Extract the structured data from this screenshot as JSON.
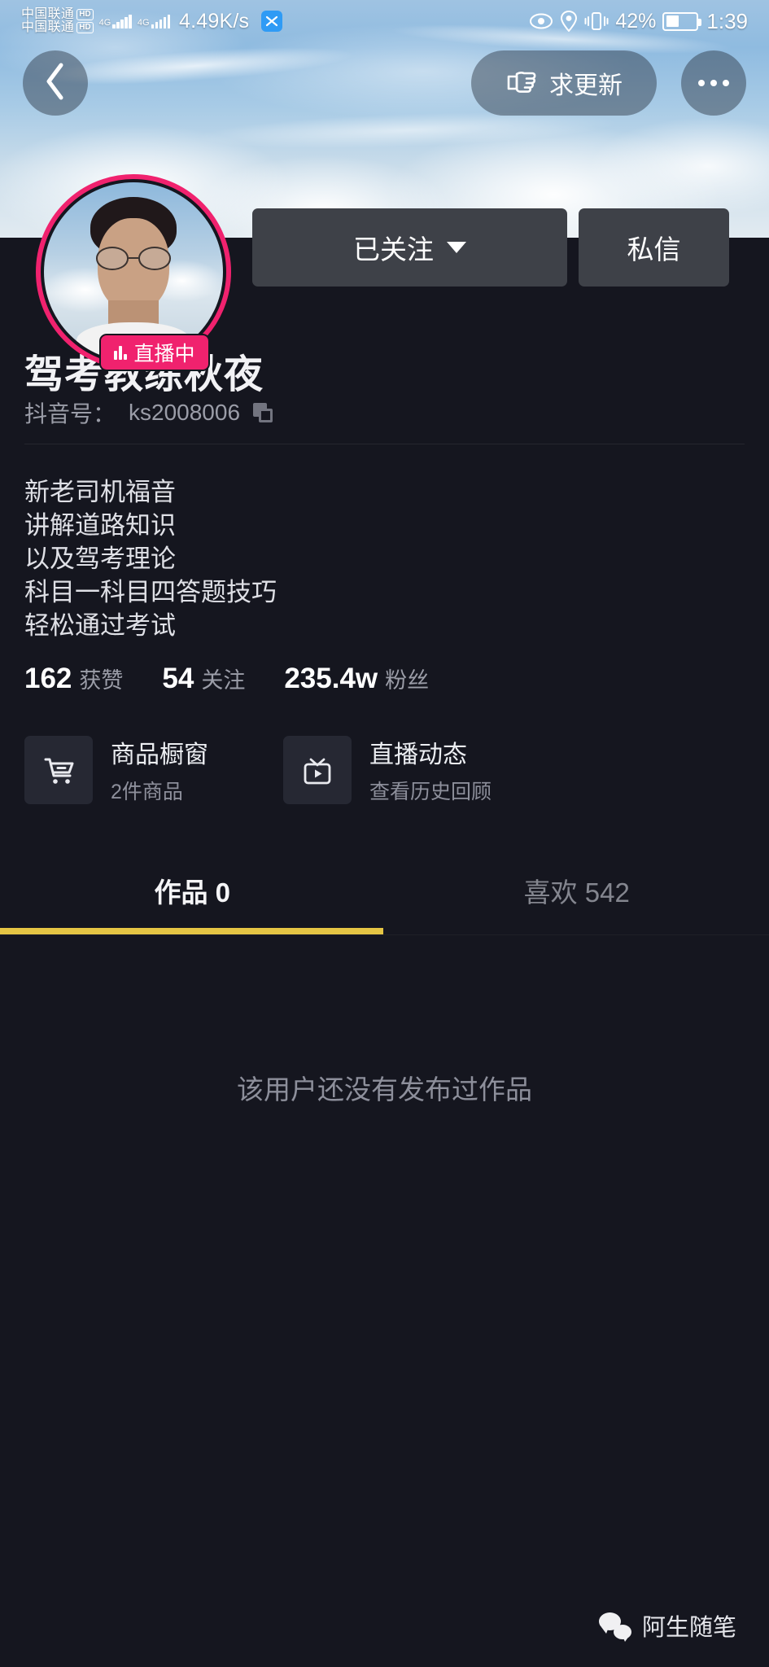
{
  "status_bar": {
    "carrier_line1": "中国联通",
    "carrier_line2": "中国联通",
    "hd_label": "HD",
    "network_type_1": "4G",
    "network_type_2": "4G",
    "network_speed": "4.49K/s",
    "app_icon": "wechat-icon",
    "eye_icon": "eye-icon",
    "location_icon": "location-pin-icon",
    "vibrate_icon": "vibrate-icon",
    "battery_percent": "42%",
    "battery_level": 42,
    "clock": "1:39"
  },
  "top_nav": {
    "back_icon": "chevron-left-icon",
    "update_button": {
      "icon": "pointing-hand-icon",
      "label": "求更新"
    },
    "more_icon": "more-horizontal-icon"
  },
  "profile": {
    "avatar_icon": "user-avatar",
    "live_badge": {
      "icon": "live-wave-icon",
      "label": "直播中"
    },
    "follow_button": {
      "label": "已关注",
      "caret_icon": "chevron-down-icon"
    },
    "message_button": {
      "label": "私信"
    },
    "nickname": "驾考教练秋夜",
    "id_label": "抖音号：",
    "id_value": "ks2008006",
    "copy_icon": "copy-icon",
    "bio_lines": [
      "新老司机福音",
      "讲解道路知识",
      "以及驾考理论",
      "科目一科目四答题技巧",
      "轻松通过考试"
    ]
  },
  "stats": [
    {
      "num": "162",
      "label": "获赞"
    },
    {
      "num": "54",
      "label": "关注"
    },
    {
      "num": "235.4w",
      "label": "粉丝"
    }
  ],
  "cards": [
    {
      "icon": "shopping-cart-icon",
      "title": "商品橱窗",
      "subtitle": "2件商品"
    },
    {
      "icon": "tv-play-icon",
      "title": "直播动态",
      "subtitle": "查看历史回顾"
    }
  ],
  "tabs": [
    {
      "label": "作品 0",
      "active": true
    },
    {
      "label": "喜欢 542",
      "active": false
    }
  ],
  "empty_state": {
    "message": "该用户还没有发布过作品"
  },
  "watermark": {
    "icon": "wechat-icon",
    "label": "阿生随笔"
  },
  "colors": {
    "background": "#15161f",
    "accent_pink": "#f0226e",
    "tab_underline": "#e5c544",
    "button_gray": "#3e4148",
    "muted_text": "#9b9da8"
  }
}
